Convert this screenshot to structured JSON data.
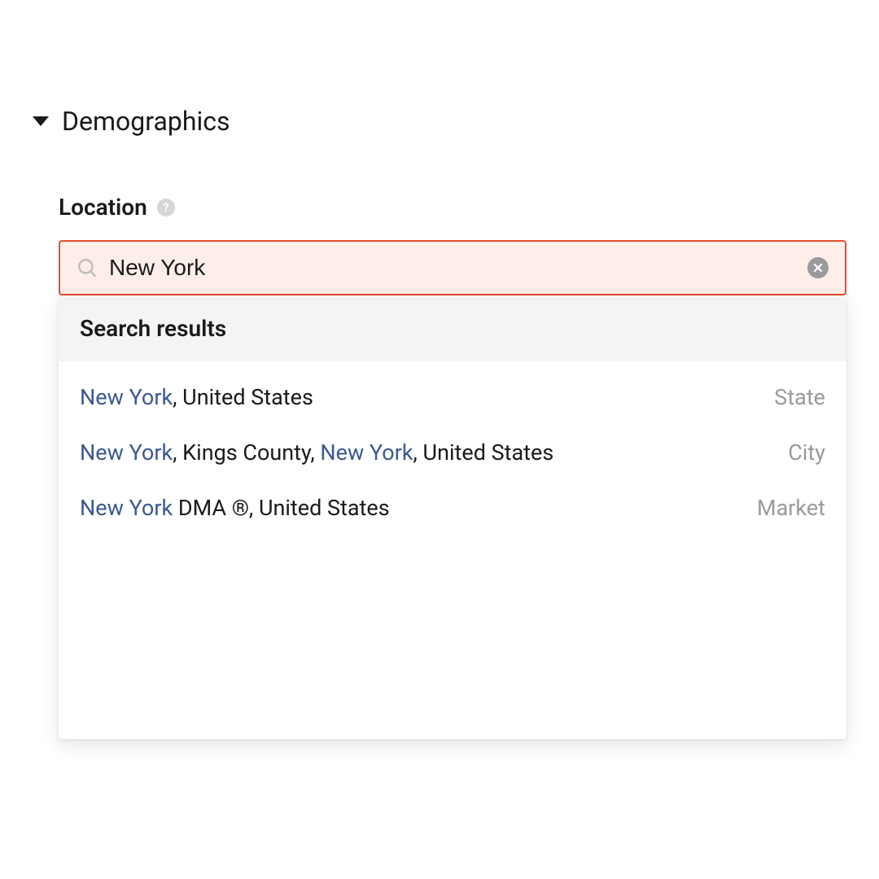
{
  "section": {
    "title": "Demographics"
  },
  "locationField": {
    "label": "Location",
    "help_symbol": "?",
    "search_value": "New York",
    "search_placeholder": ""
  },
  "dropdown": {
    "header": "Search results",
    "results": [
      {
        "parts": [
          {
            "text": "New York",
            "hl": true
          },
          {
            "text": ", United States",
            "hl": false
          }
        ],
        "type": "State"
      },
      {
        "parts": [
          {
            "text": "New York",
            "hl": true
          },
          {
            "text": ", Kings County, ",
            "hl": false
          },
          {
            "text": "New York",
            "hl": true
          },
          {
            "text": ", United States",
            "hl": false
          }
        ],
        "type": "City"
      },
      {
        "parts": [
          {
            "text": "New York",
            "hl": true
          },
          {
            "text": " DMA ®, United States",
            "hl": false
          }
        ],
        "type": "Market"
      }
    ]
  },
  "colors": {
    "accent_border": "#e64d2e",
    "accent_bg": "#fdeee9",
    "highlight_text": "#3b5894",
    "muted_text": "#9a9a9a"
  }
}
